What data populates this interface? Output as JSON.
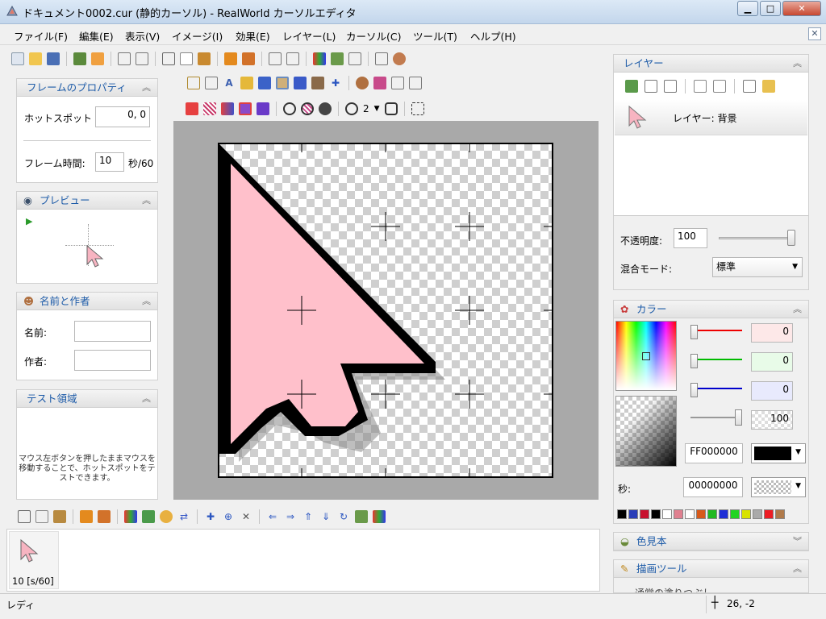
{
  "window": {
    "title": "ドキュメント0002.cur (静的カーソル) - RealWorld カーソルエディタ",
    "min": "▁",
    "max": "□",
    "close": "✕"
  },
  "menu": [
    "ファイル(F)",
    "編集(E)",
    "表示(V)",
    "イメージ(I)",
    "効果(E)",
    "レイヤー(L)",
    "カーソル(C)",
    "ツール(T)",
    "ヘルプ(H)"
  ],
  "mdi_close": "✕",
  "frame_props": {
    "title": "フレームのプロパティ",
    "hotspot_label": "ホットスポット",
    "hotspot_value": "0, 0",
    "frametime_label": "フレーム時間:",
    "frametime_value": "10",
    "frametime_unit": "秒/60"
  },
  "preview": {
    "title": "プレビュー"
  },
  "name_author": {
    "title": "名前と作者",
    "name_label": "名前:",
    "author_label": "作者:"
  },
  "test_area": {
    "title": "テスト領域",
    "text": "マウス左ボタンを押したままマウスを移動することで、ホットスポットをテストできます。"
  },
  "tool_size": "2",
  "frames": [
    {
      "label": "10 [s/60]"
    }
  ],
  "layers": {
    "title": "レイヤー",
    "item": "レイヤー: 背景",
    "opacity_label": "不透明度:",
    "opacity_value": "100",
    "blend_label": "混合モード:",
    "blend_value": "標準"
  },
  "color": {
    "title": "カラー",
    "r": "0",
    "g": "0",
    "b": "0",
    "a": "100",
    "hex": "FF000000",
    "sec_label": "秒:",
    "sec_hex": "00000000"
  },
  "palette": [
    "#000000",
    "#2a3eb8",
    "#c8102e",
    "#000000",
    "#ffffff",
    "#e08090",
    "#ffffff",
    "#d85a1a",
    "#21b921",
    "#1f2fd6",
    "#22d422",
    "#d8e300",
    "#aaaaaa",
    "#ee1c24",
    "#b07a4a"
  ],
  "swatches_panel": {
    "title": "色見本"
  },
  "draw_tools": {
    "title": "描画ツール",
    "item": "通常の塗りつぶし"
  },
  "status": {
    "text": "レディ",
    "coords": "26, -2"
  }
}
